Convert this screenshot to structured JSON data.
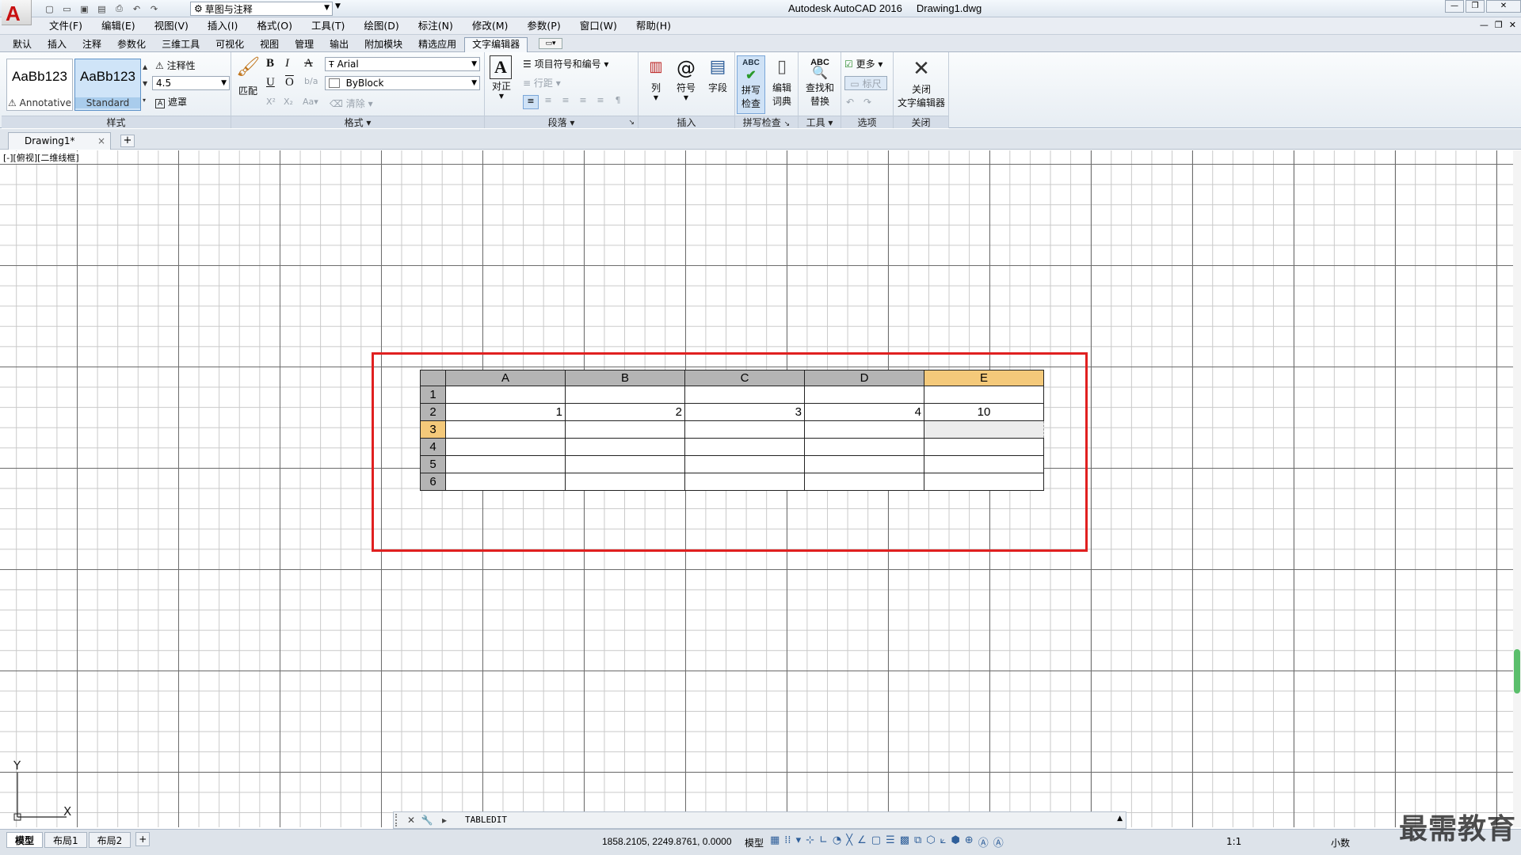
{
  "titlebar": {
    "workspace": "草图与注释",
    "app_title": "Autodesk AutoCAD 2016",
    "doc_title": "Drawing1.dwg"
  },
  "menu": [
    "文件(F)",
    "编辑(E)",
    "视图(V)",
    "插入(I)",
    "格式(O)",
    "工具(T)",
    "绘图(D)",
    "标注(N)",
    "修改(M)",
    "参数(P)",
    "窗口(W)",
    "帮助(H)"
  ],
  "ribbon_tabs": [
    "默认",
    "插入",
    "注释",
    "参数化",
    "三维工具",
    "可视化",
    "视图",
    "管理",
    "输出",
    "附加模块",
    "精选应用",
    "文字编辑器"
  ],
  "active_tab": "文字编辑器",
  "ribbon": {
    "style": {
      "swatch1_text": "AaBb123",
      "swatch1_label": "Annotative",
      "swatch2_text": "AaBb123",
      "swatch2_label": "Standard",
      "annotative": "注释性",
      "height": "4.5",
      "mask": "遮罩",
      "title": "样式"
    },
    "format": {
      "match": "匹配",
      "bold": "B",
      "italic": "I",
      "strike": "A",
      "underline": "U",
      "overline": "O",
      "font": "Arial",
      "color": "ByBlock",
      "clear": "清除",
      "title": "格式"
    },
    "paragraph": {
      "justify": "对正",
      "bullets": "项目符号和编号",
      "line_spacing": "行距",
      "title": "段落"
    },
    "insert": {
      "columns": "列",
      "symbol": "符号",
      "field": "字段",
      "title": "插入"
    },
    "spell": {
      "check_top": "拼写",
      "check_bottom": "检查",
      "dict_top": "编辑",
      "dict_bottom": "词典",
      "title": "拼写检查"
    },
    "tools": {
      "find_top": "查找和",
      "find_bottom": "替换",
      "title": "工具"
    },
    "options": {
      "more": "更多",
      "ruler": "标尺",
      "title": "选项"
    },
    "close": {
      "top": "关闭",
      "bottom": "文字编辑器",
      "title": "关闭"
    }
  },
  "doc_tab": {
    "name": "Drawing1*"
  },
  "viewport_label": "[-][俯视][二维线框]",
  "table": {
    "columns": [
      "A",
      "B",
      "C",
      "D",
      "E"
    ],
    "rows": [
      {
        "label": "1",
        "cells": [
          "",
          "",
          "",
          "",
          ""
        ]
      },
      {
        "label": "2",
        "cells": [
          "1",
          "2",
          "3",
          "4",
          "10"
        ]
      },
      {
        "label": "3",
        "cells": [
          "",
          "",
          "",
          "",
          ""
        ]
      },
      {
        "label": "4",
        "cells": [
          "",
          "",
          "",
          "",
          ""
        ]
      },
      {
        "label": "5",
        "cells": [
          "",
          "",
          "",
          "",
          ""
        ]
      },
      {
        "label": "6",
        "cells": [
          "",
          "",
          "",
          "",
          ""
        ]
      }
    ],
    "selected_column": "E",
    "selected_row": "3"
  },
  "ucs": {
    "y": "Y",
    "x": "X"
  },
  "command": {
    "text": "TABLEDIT"
  },
  "status": {
    "layout_tabs": [
      "模型",
      "布局1",
      "布局2"
    ],
    "coords": "1858.2105, 2249.8761, 0.0000",
    "model": "模型",
    "scale": "1:1",
    "units": "小数"
  },
  "watermark": "最需教育",
  "colors": {
    "selection": "#f4c97a",
    "redbox": "#e02020",
    "app_red": "#c81010"
  }
}
